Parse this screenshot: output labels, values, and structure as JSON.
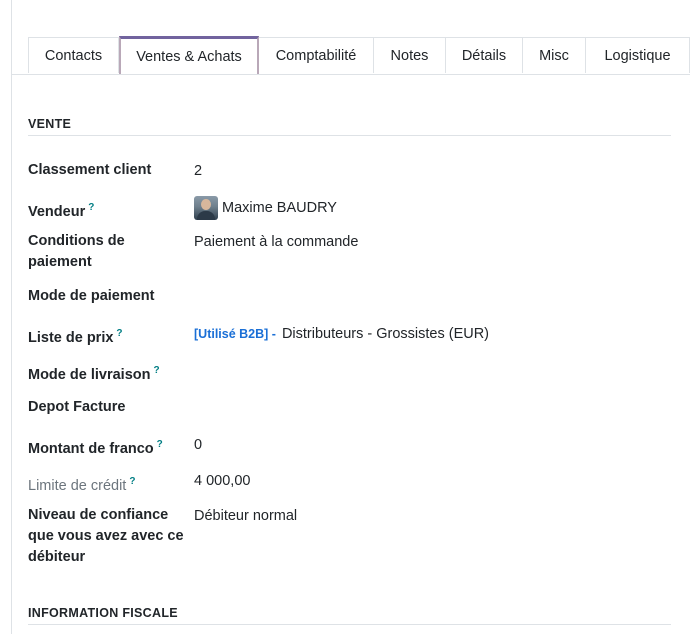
{
  "tabs": [
    {
      "label": "Contacts",
      "active": false
    },
    {
      "label": "Ventes & Achats",
      "active": true
    },
    {
      "label": "Comptabilité",
      "active": false
    },
    {
      "label": "Notes",
      "active": false
    },
    {
      "label": "Détails",
      "active": false
    },
    {
      "label": "Misc",
      "active": false
    },
    {
      "label": "Logistique",
      "active": false
    }
  ],
  "sections": {
    "vente_title": "VENTE",
    "fiscal_title": "INFORMATION FISCALE"
  },
  "fields": {
    "classement": {
      "label": "Classement client",
      "value": "2"
    },
    "vendeur": {
      "label": "Vendeur",
      "help": "?",
      "value": "Maxime BAUDRY"
    },
    "conditions": {
      "label": "Conditions de paiement",
      "value": "Paiement à la commande"
    },
    "mode_paiement": {
      "label": "Mode de paiement",
      "value": ""
    },
    "liste_prix": {
      "label": "Liste de prix",
      "help": "?",
      "tag": "[Utilisé B2B] -",
      "value": "Distributeurs - Grossistes (EUR)"
    },
    "mode_livraison": {
      "label": "Mode de livraison",
      "help": "?",
      "value": ""
    },
    "depot_facture": {
      "label": "Depot Facture",
      "value": ""
    },
    "montant_franco": {
      "label": "Montant de franco",
      "help": "?",
      "value": "0"
    },
    "limite_credit": {
      "label": "Limite de crédit",
      "help": "?",
      "value": "4 000,00"
    },
    "niveau_confiance": {
      "label": "Niveau de confiance que vous avez avec ce débiteur",
      "value": "Débiteur normal"
    }
  },
  "colors": {
    "active_tab_accent": "#71639e",
    "link_blue": "#1a6fd6",
    "help_teal": "#017e84"
  }
}
